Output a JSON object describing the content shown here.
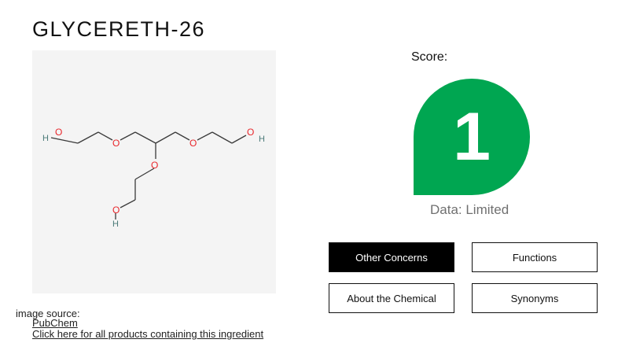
{
  "ingredient": {
    "name": "GLYCERETH-26"
  },
  "image_source": {
    "label": "image source:",
    "source_link": "PubChem",
    "products_link": "Click here for all products containing this ingredient"
  },
  "structure": {
    "atom_o": "O",
    "atom_h": "H"
  },
  "score": {
    "label": "Score:",
    "value": "1",
    "data_quality": "Data: Limited",
    "color": "#00a651"
  },
  "tabs": [
    {
      "label": "Other Concerns",
      "active": true
    },
    {
      "label": "Functions",
      "active": false
    },
    {
      "label": "About the Chemical",
      "active": false
    },
    {
      "label": "Synonyms",
      "active": false
    }
  ]
}
